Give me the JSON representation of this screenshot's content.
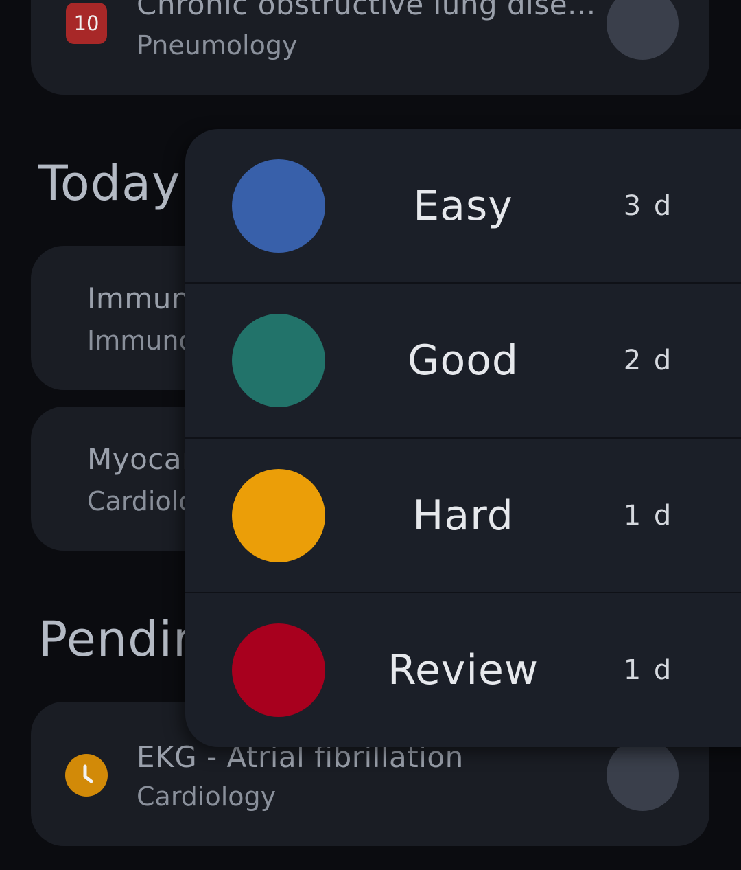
{
  "cards": {
    "top": {
      "badge": "10",
      "title": "Chronic obstructive lung dise...",
      "subtitle": "Pneumology"
    },
    "immuno": {
      "title": "Immune",
      "subtitle": "Immuno"
    },
    "myo": {
      "title": "Myocar",
      "subtitle": "Cardiolo"
    },
    "ekg": {
      "title": "EKG - Atrial fibrillation",
      "subtitle": "Cardiology"
    }
  },
  "sections": {
    "today": "Today",
    "pending": "Pendir"
  },
  "popup": {
    "options": [
      {
        "label": "Easy",
        "interval": "3 d",
        "color": "#3860aa"
      },
      {
        "label": "Good",
        "interval": "2 d",
        "color": "#22736a"
      },
      {
        "label": "Hard",
        "interval": "1 d",
        "color": "#eb9e08"
      },
      {
        "label": "Review",
        "interval": "1 d",
        "color": "#a8001e"
      }
    ]
  },
  "colors": {
    "background": "#0b0c10",
    "card": "#1a1d24",
    "popup": "#1b1f28",
    "badge_red": "#a82828",
    "clock_badge": "#d28a08",
    "placeholder_circle": "#3a3f4b"
  },
  "icons": {
    "ekg_status": "clock-icon"
  }
}
